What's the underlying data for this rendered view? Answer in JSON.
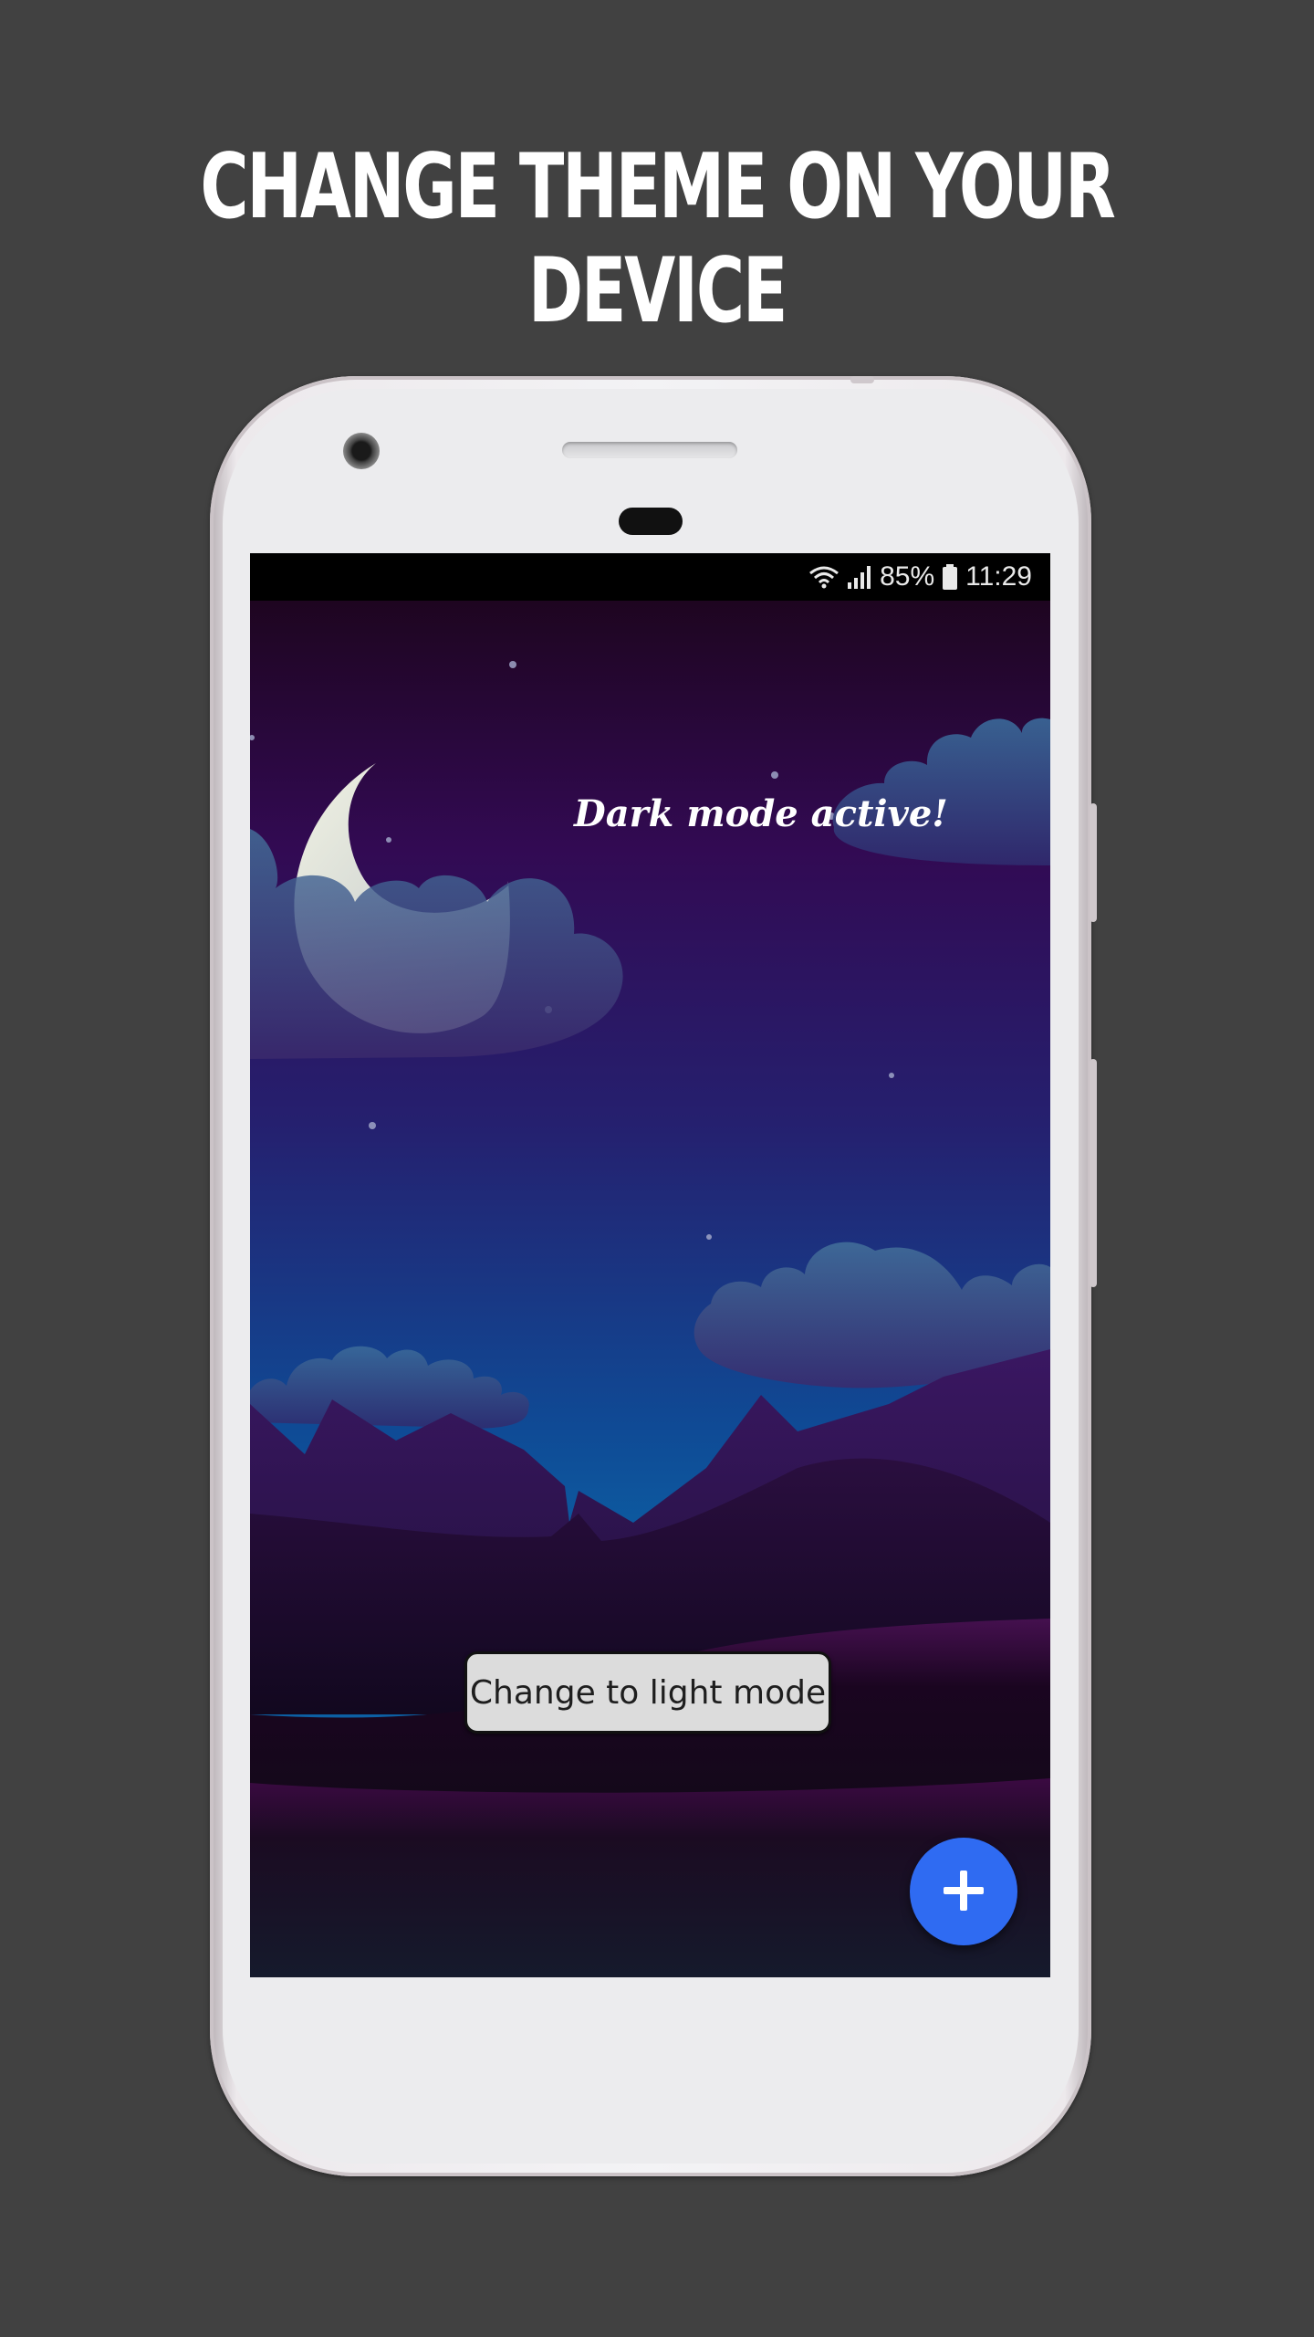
{
  "promo": {
    "headline": "CHANGE THEME ON YOUR DEVICE"
  },
  "status_bar": {
    "battery_percent": "85%",
    "time": "11:29",
    "icons": [
      "wifi-icon",
      "signal-icon",
      "battery-icon"
    ]
  },
  "app": {
    "status_label": "Dark mode active!",
    "toggle_button_label": "Change to light mode",
    "fab_icon": "plus-icon"
  },
  "colors": {
    "fab": "#2f6bf2",
    "button_background": "#dcdcdc",
    "background": "#414141"
  }
}
